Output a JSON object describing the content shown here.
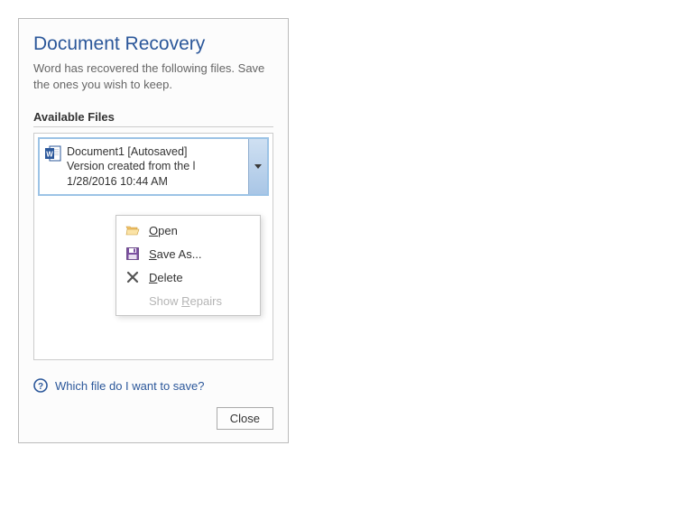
{
  "title": "Document Recovery",
  "description": "Word has recovered the following files. Save the ones you wish to keep.",
  "section_label": "Available Files",
  "file": {
    "name": "Document1  [Autosaved]",
    "line2": "Version created from the l",
    "line3": "1/28/2016 10:44 AM"
  },
  "menu": {
    "open": "Open",
    "save_as": "Save As...",
    "delete": "Delete",
    "show_repairs": "Show Repairs"
  },
  "help_link": "Which file do I want to save?",
  "close_button": "Close"
}
